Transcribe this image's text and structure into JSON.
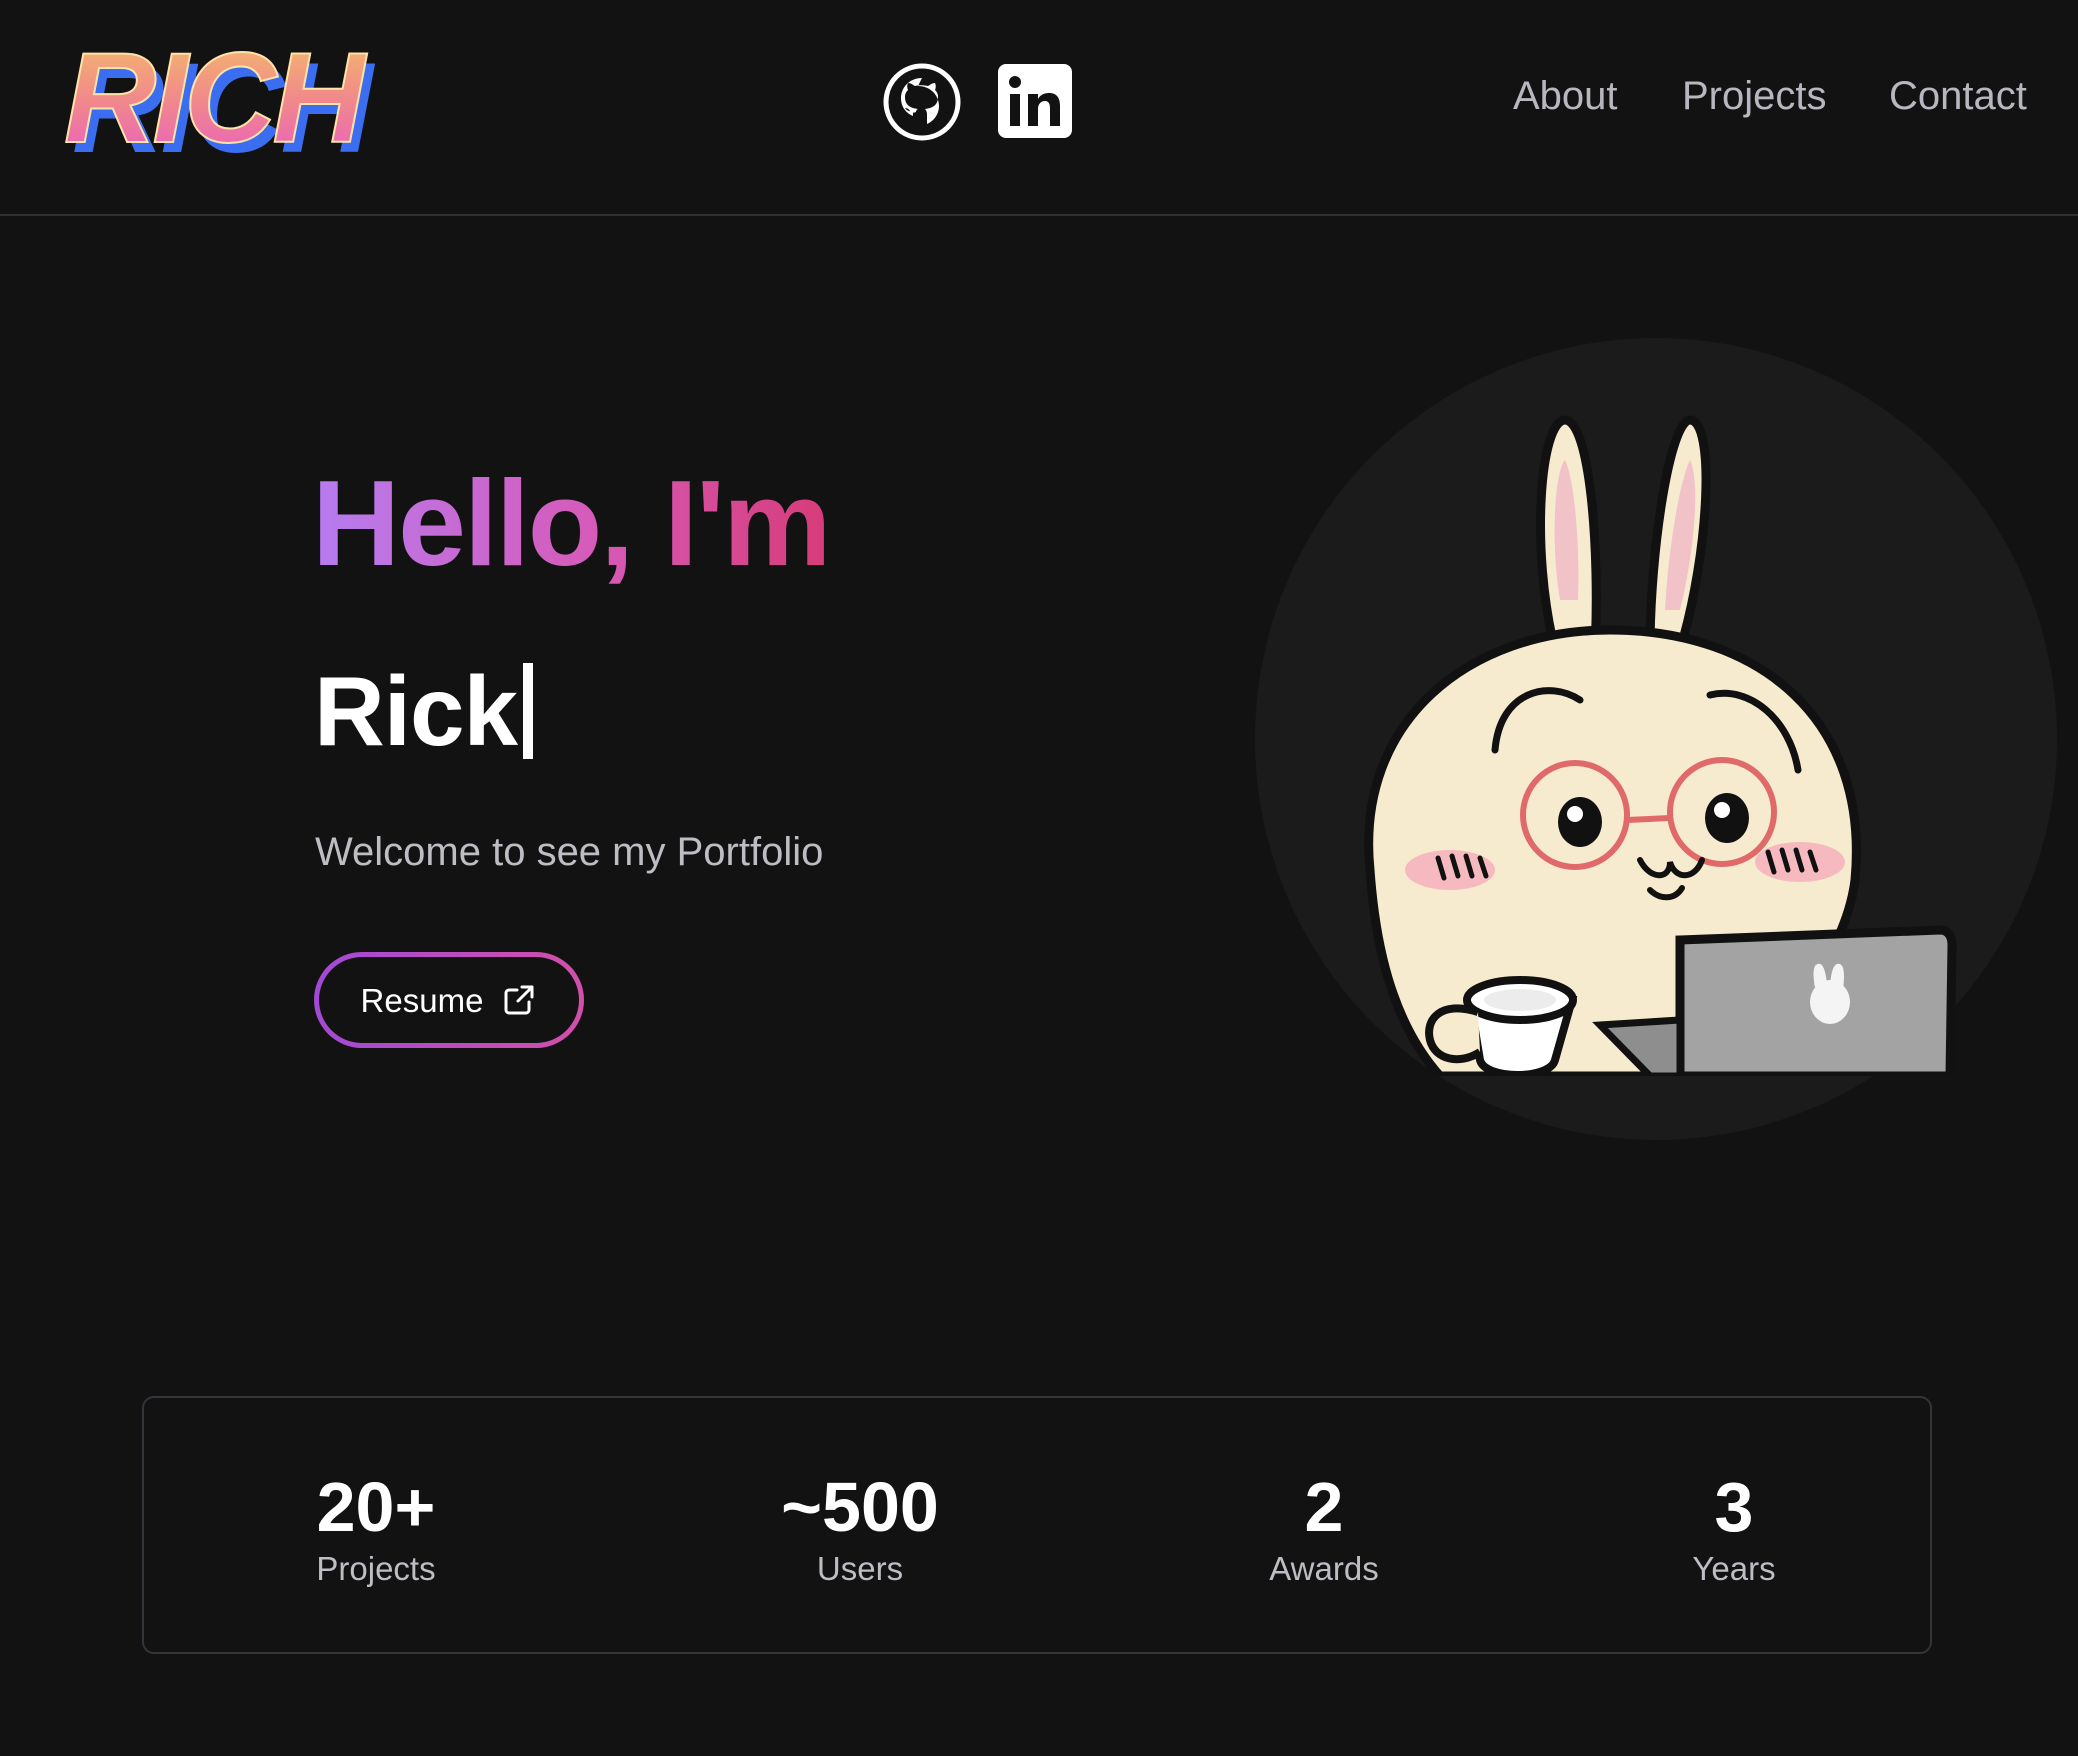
{
  "header": {
    "logo_text": "RICH",
    "social": [
      {
        "icon": "github-icon"
      },
      {
        "icon": "linkedin-icon",
        "text": "in"
      }
    ],
    "nav": [
      "About",
      "Projects",
      "Contact"
    ]
  },
  "hero": {
    "greeting": "Hello, I'm",
    "name": "Rick",
    "subtitle": "Welcome to see my Portfolio",
    "resume_label": "Resume",
    "resume_icon": "external-link-icon"
  },
  "avatar": {
    "description_icon": "bunny-with-laptop-illustration"
  },
  "stats": [
    {
      "value": "20+",
      "label": "Projects"
    },
    {
      "value": "~500",
      "label": "Users"
    },
    {
      "value": "2",
      "label": "Awards"
    },
    {
      "value": "3",
      "label": "Years"
    }
  ],
  "colors": {
    "background": "#121212",
    "gradient_start": "#b67cf0",
    "gradient_end": "#d63c78",
    "muted_text": "#bdbdc4"
  }
}
